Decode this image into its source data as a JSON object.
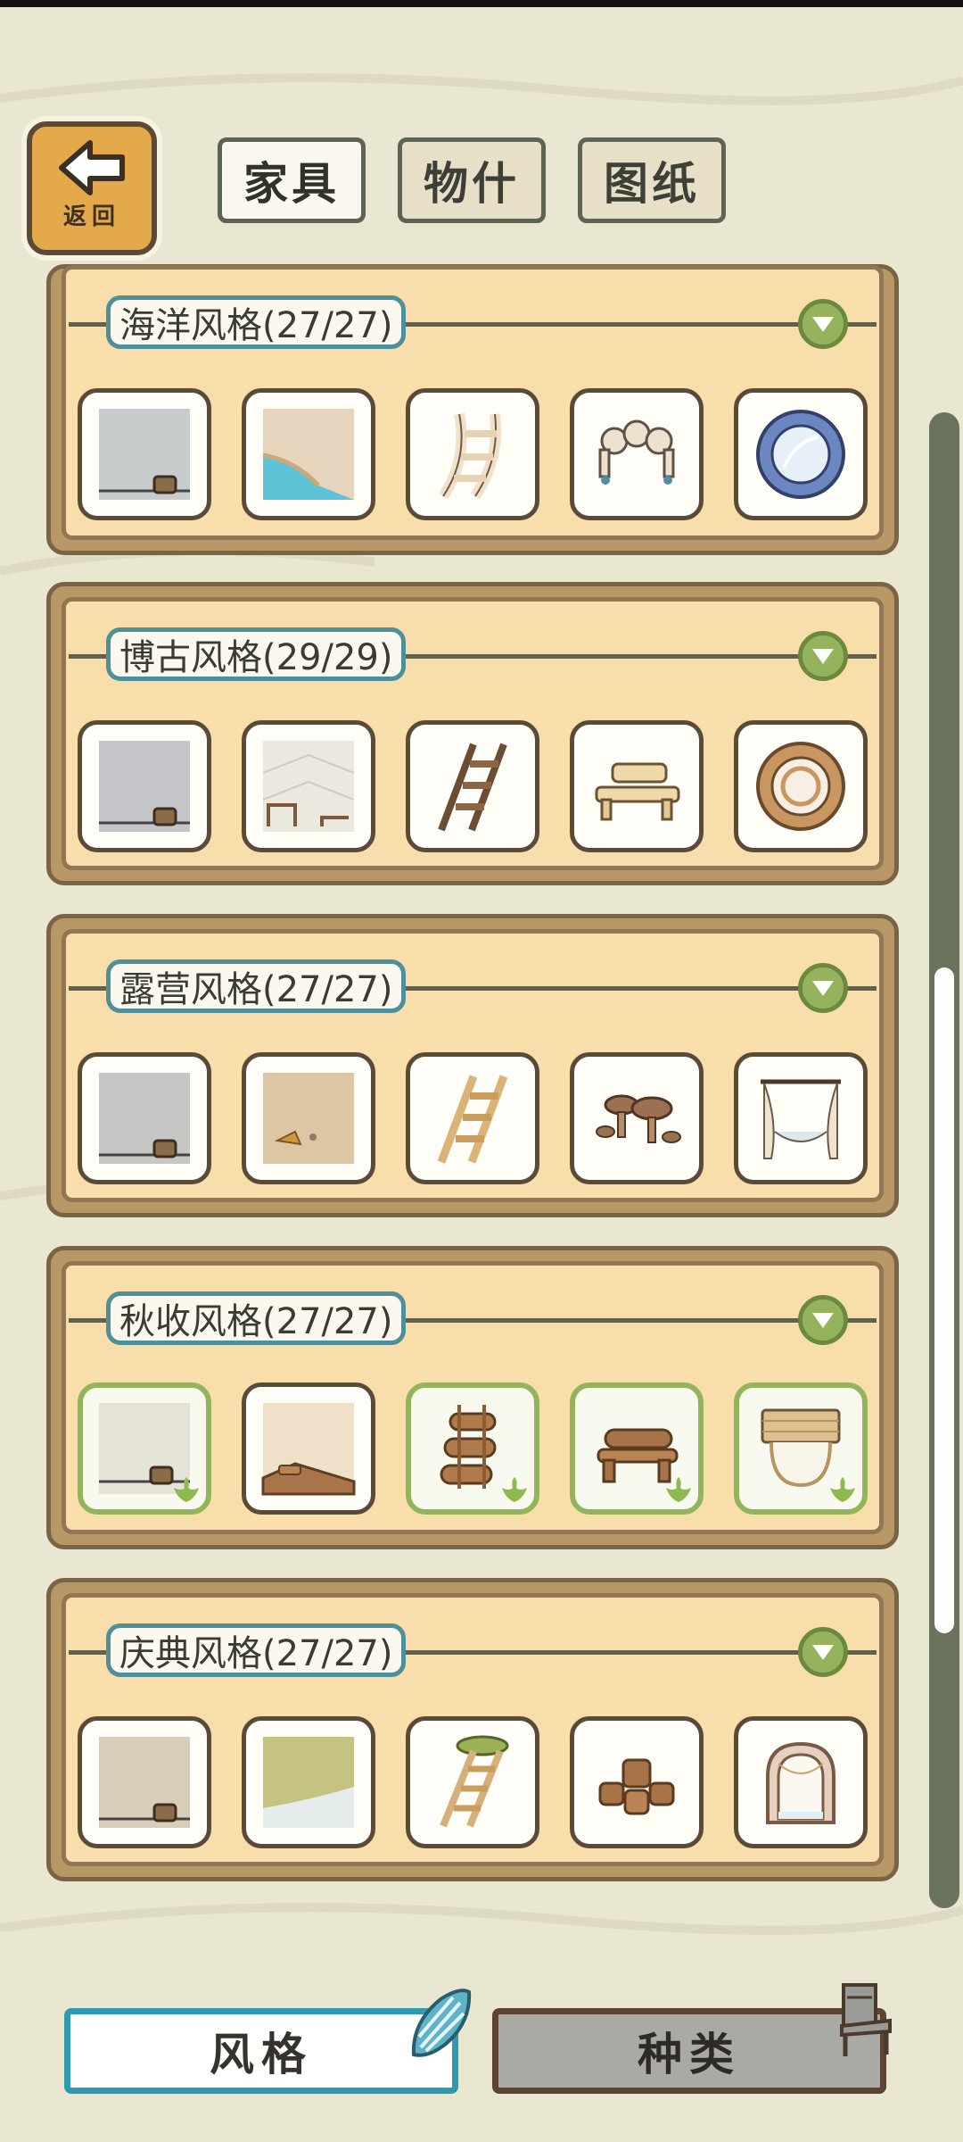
{
  "header": {
    "back_label": "返回",
    "tabs": [
      {
        "label": "家具",
        "active": true
      },
      {
        "label": "物什",
        "active": false
      },
      {
        "label": "图纸",
        "active": false
      }
    ]
  },
  "sets": [
    {
      "title": "海洋风格(27/27)",
      "items": [
        "wall-icon",
        "floor-pool-icon",
        "ladder-icon",
        "shell-seats-icon",
        "porthole-window-icon"
      ],
      "owned": [
        false,
        false,
        false,
        false,
        false
      ]
    },
    {
      "title": "博古风格(29/29)",
      "items": [
        "wall-icon",
        "floor-tile-icon",
        "ladder-icon",
        "bench-icon",
        "round-window-icon"
      ],
      "owned": [
        false,
        false,
        false,
        false,
        false
      ]
    },
    {
      "title": "露营风格(27/27)",
      "items": [
        "wall-icon",
        "floor-sand-icon",
        "ladder-icon",
        "mushroom-tables-icon",
        "curtain-window-icon"
      ],
      "owned": [
        false,
        false,
        false,
        false,
        false
      ]
    },
    {
      "title": "秋收风格(27/27)",
      "items": [
        "wall-icon",
        "floor-wood-icon",
        "log-ladder-icon",
        "log-bench-icon",
        "bamboo-window-icon"
      ],
      "owned": [
        true,
        false,
        true,
        true,
        true
      ]
    },
    {
      "title": "庆典风格(27/27)",
      "items": [
        "wall-icon",
        "floor-grass-icon",
        "moss-ladder-icon",
        "barrel-seats-icon",
        "arch-window-icon"
      ],
      "owned": [
        false,
        false,
        false,
        false,
        false
      ]
    }
  ],
  "bottom_tabs": [
    {
      "label": "风格",
      "active": true,
      "icon": "seashell-icon"
    },
    {
      "label": "种类",
      "active": false,
      "icon": "chair-icon"
    }
  ],
  "colors": {
    "background": "#e9e6d1",
    "panel": "#f8deaa",
    "title_border": "#4f8f9a",
    "owned_border": "#93b45a",
    "active_tab_border": "#2f9bb0"
  }
}
